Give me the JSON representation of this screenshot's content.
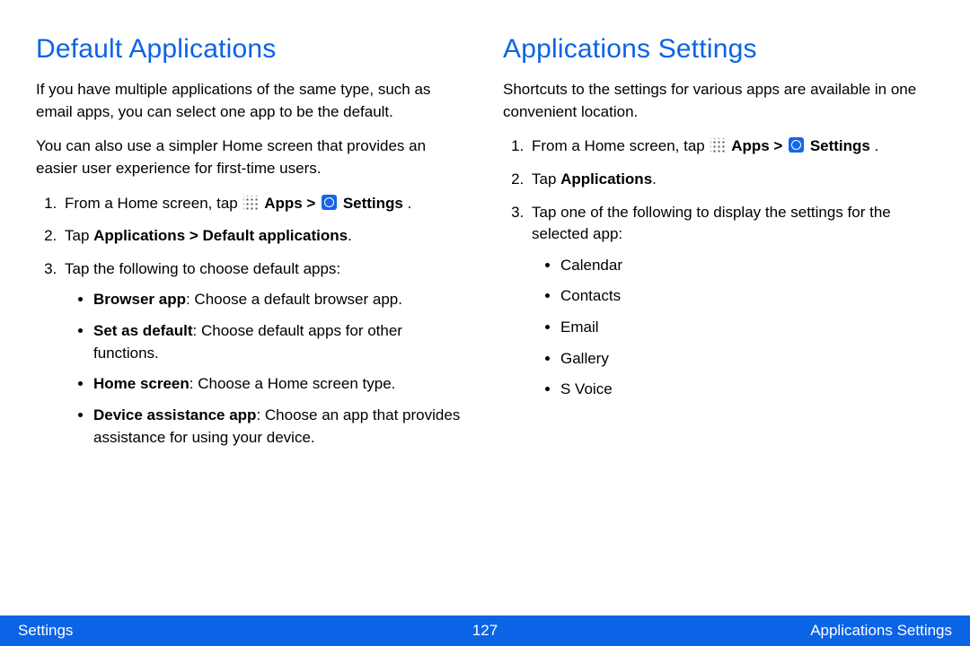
{
  "left": {
    "heading": "Default Applications",
    "p1": "If you have multiple applications of the same type, such as email apps, you can select one app to be the default.",
    "p2": "You can also use a simpler Home screen that provides an easier user experience for first-time users.",
    "step1_pre": "From a Home screen, tap ",
    "step1_apps": "Apps > ",
    "step1_settings": "Settings",
    "step1_post": " .",
    "step2_pre": "Tap ",
    "step2_bold": "Applications > Default applications",
    "step2_post": ".",
    "step3": "Tap the following to choose default apps:",
    "bullets": [
      {
        "bold": "Browser app",
        "rest": ": Choose a default browser app."
      },
      {
        "bold": "Set as default",
        "rest": ": Choose default apps for other functions."
      },
      {
        "bold": "Home screen",
        "rest": ": Choose a Home screen type."
      },
      {
        "bold": "Device assistance app",
        "rest": ": Choose an app that provides assistance for using your device."
      }
    ]
  },
  "right": {
    "heading": "Applications Settings",
    "p1": "Shortcuts to the settings for various apps are available in one convenient location.",
    "step1_pre": "From a Home screen, tap ",
    "step1_apps": "Apps > ",
    "step1_settings": "Settings",
    "step1_post": " .",
    "step2_pre": "Tap ",
    "step2_bold": "Applications",
    "step2_post": ".",
    "step3": "Tap one of the following to display the settings for the selected app:",
    "bullets": [
      "Calendar",
      "Contacts",
      "Email",
      "Gallery",
      "S Voice"
    ]
  },
  "footer": {
    "left": "Settings",
    "page": "127",
    "right": "Applications Settings"
  }
}
